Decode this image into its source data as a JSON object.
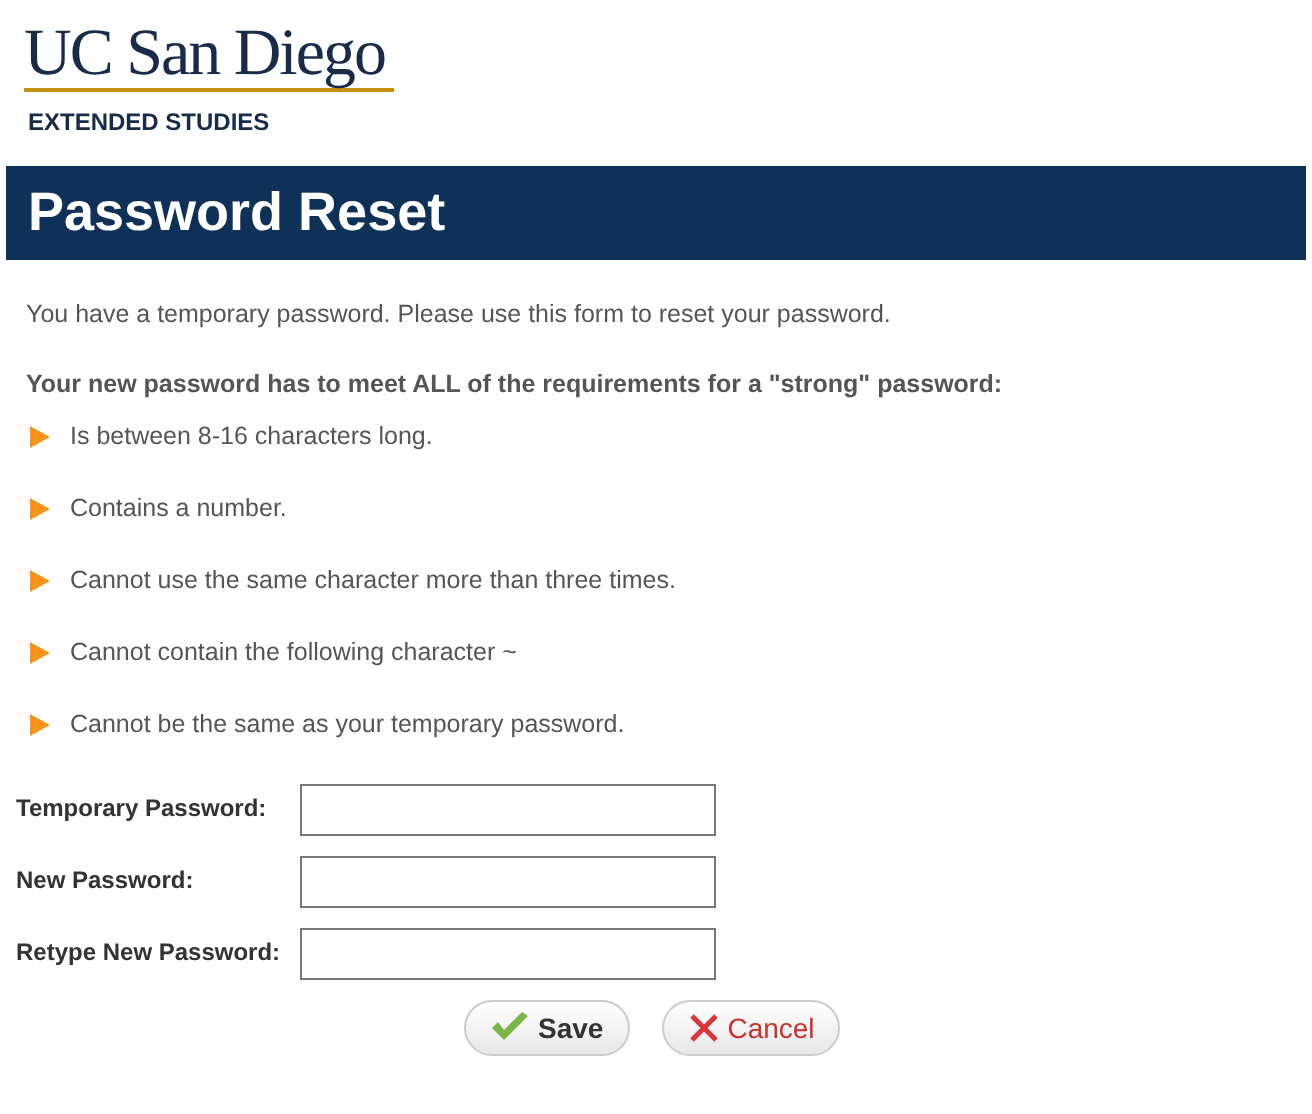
{
  "logo": {
    "name": "UC San Diego",
    "subtitle": "EXTENDED STUDIES"
  },
  "header": {
    "title": "Password Reset"
  },
  "intro": "You have a temporary password. Please use this form to reset your password.",
  "requirements_heading": "Your new password has to meet ALL of the requirements for a \"strong\" password:",
  "requirements": [
    "Is between 8-16 characters long.",
    "Contains a number.",
    "Cannot use the same character more than three times.",
    "Cannot contain the following character ~",
    "Cannot be the same as your temporary password."
  ],
  "fields": [
    {
      "label": "Temporary Password:"
    },
    {
      "label": "New Password:"
    },
    {
      "label": "Retype New Password:"
    }
  ],
  "buttons": [
    {
      "kind": "save",
      "label": "Save"
    },
    {
      "kind": "cancel",
      "label": "Cancel"
    }
  ]
}
